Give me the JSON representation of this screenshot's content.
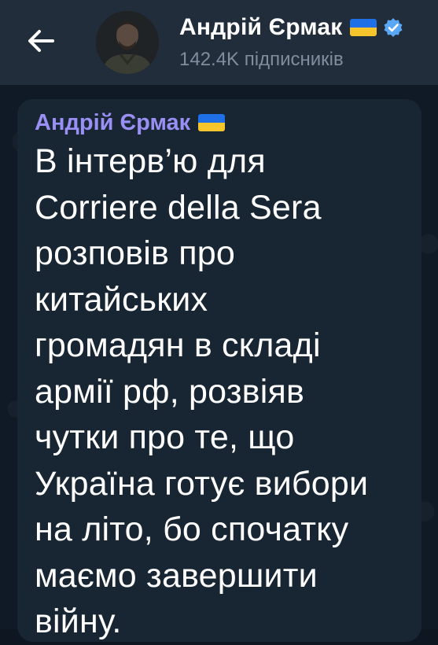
{
  "header": {
    "channel_name": "Андрій Єрмак",
    "subscribers": "142.4K підписників",
    "back_icon": "arrow-left-icon",
    "verified_icon": "verified-badge-icon",
    "flag_icon": "ukraine-flag-icon"
  },
  "message": {
    "sender": "Андрій Єрмак",
    "lines": [
      "В інтерв’ю для",
      "Corriere della Sera",
      "розповів про",
      "китайських",
      "громадян в складі",
      "армії рф, розвіяв",
      "чутки про те, що",
      "Україна готує вибори",
      "на літо, бо спочатку",
      "маємо завершити",
      "війну."
    ]
  },
  "colors": {
    "header_bg": "#212d3b",
    "chat_bg": "#0f1a26",
    "bubble_bg": "#182533",
    "sender_color": "#9a8ff4",
    "subtitle_color": "#7f8d9c",
    "verified_color": "#5aa7f5",
    "flag_blue": "#1f6fe6",
    "flag_yellow": "#f6c52b"
  }
}
